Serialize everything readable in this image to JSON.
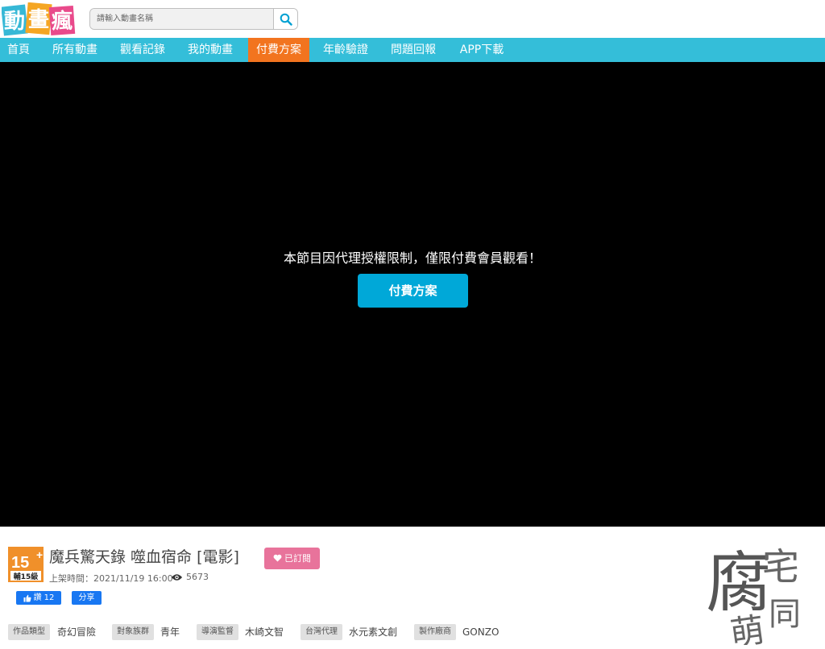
{
  "header": {
    "logo_text": "動畫瘋",
    "search_placeholder": "請輸入動畫名稱"
  },
  "nav": {
    "items": [
      {
        "label": "首頁"
      },
      {
        "label": "所有動畫"
      },
      {
        "label": "觀看記錄"
      },
      {
        "label": "我的動畫"
      },
      {
        "label": "付費方案"
      },
      {
        "label": "年齡驗證"
      },
      {
        "label": "問題回報"
      },
      {
        "label": "APP下載"
      }
    ],
    "active_index": 4,
    "bar_color": "#34bed9",
    "active_color": "#f2741f"
  },
  "player": {
    "message": "本節目因代理授權限制，僅限付費會員觀看！",
    "button_label": "付費方案"
  },
  "info": {
    "rating_number": "15",
    "rating_label": "輔15級",
    "title": "魔兵驚天錄 噬血宿命 [電影]",
    "subscribe_label": "已訂閱",
    "release": "上架時間：2021/11/19 16:00",
    "views": "5673",
    "like_label": "讚",
    "like_count": "12",
    "share_label": "分享",
    "tags": [
      {
        "label": "作品類型",
        "value": "奇幻冒險"
      },
      {
        "label": "對象族群",
        "value": "青年"
      },
      {
        "label": "導演監督",
        "value": "木崎文智"
      },
      {
        "label": "台灣代理",
        "value": "水元素文創"
      },
      {
        "label": "製作廠商",
        "value": "GONZO"
      }
    ],
    "stamp_text": "腐宅萌同"
  }
}
